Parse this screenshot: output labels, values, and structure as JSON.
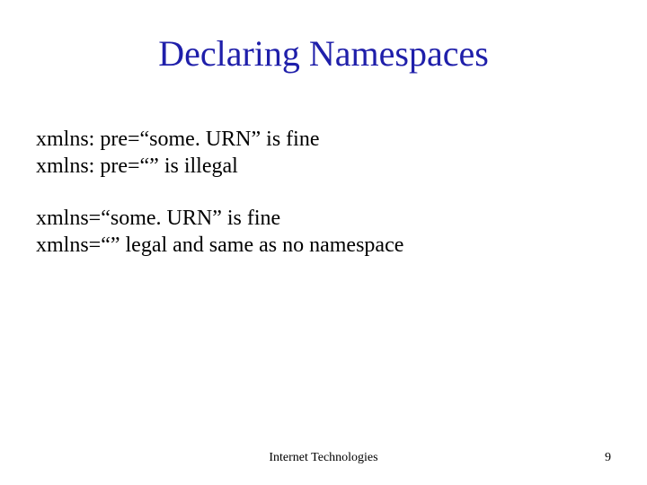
{
  "title": "Declaring Namespaces",
  "body": {
    "p1_l1": "xmlns: pre=“some. URN”  is fine",
    "p1_l2": "xmlns: pre=“” is illegal",
    "p2_l1": "xmlns=“some. URN” is fine",
    "p2_l2": "xmlns=“” legal and same as no namespace"
  },
  "footer": {
    "center": "Internet Technologies",
    "page": "9"
  }
}
